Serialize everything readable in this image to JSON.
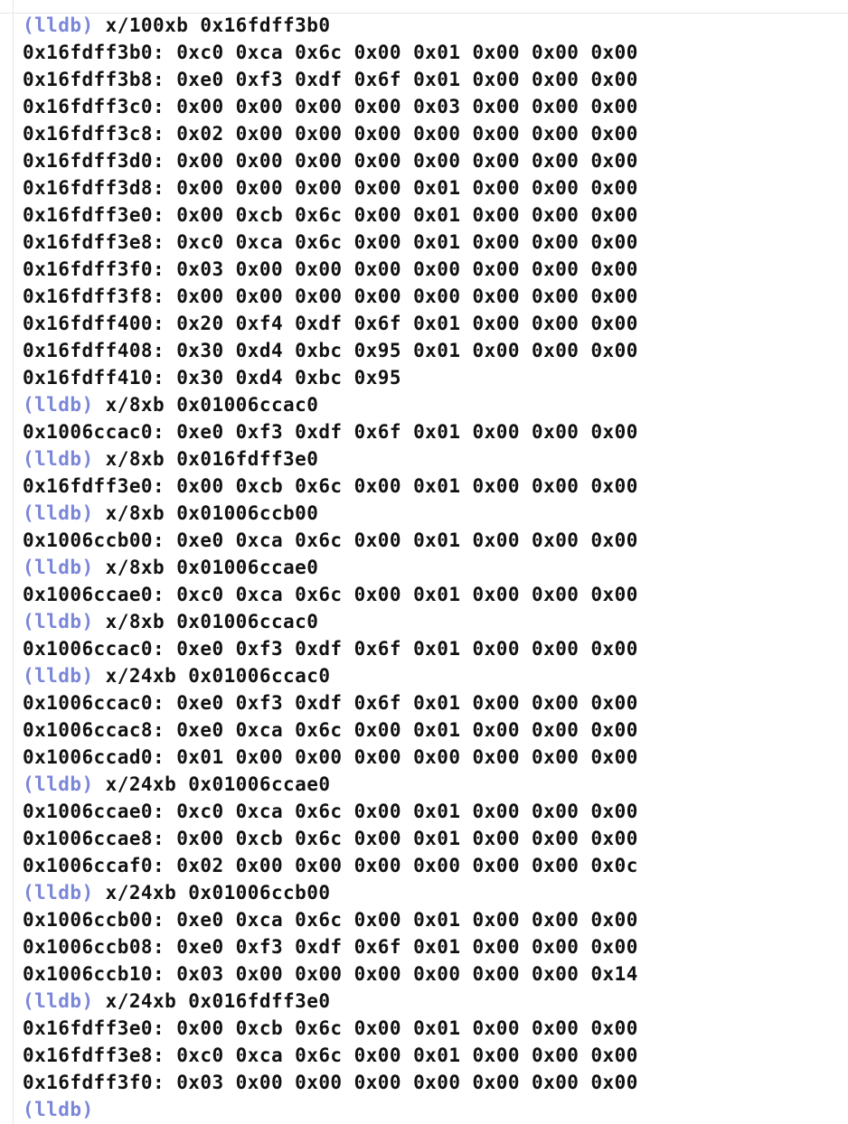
{
  "console": {
    "prompt": "(lldb)",
    "lines": [
      {
        "kind": "cmd",
        "text": "x/100xb 0x16fdff3b0"
      },
      {
        "kind": "out",
        "text": "0x16fdff3b0: 0xc0 0xca 0x6c 0x00 0x01 0x00 0x00 0x00"
      },
      {
        "kind": "out",
        "text": "0x16fdff3b8: 0xe0 0xf3 0xdf 0x6f 0x01 0x00 0x00 0x00"
      },
      {
        "kind": "out",
        "text": "0x16fdff3c0: 0x00 0x00 0x00 0x00 0x03 0x00 0x00 0x00"
      },
      {
        "kind": "out",
        "text": "0x16fdff3c8: 0x02 0x00 0x00 0x00 0x00 0x00 0x00 0x00"
      },
      {
        "kind": "out",
        "text": "0x16fdff3d0: 0x00 0x00 0x00 0x00 0x00 0x00 0x00 0x00"
      },
      {
        "kind": "out",
        "text": "0x16fdff3d8: 0x00 0x00 0x00 0x00 0x01 0x00 0x00 0x00"
      },
      {
        "kind": "out",
        "text": "0x16fdff3e0: 0x00 0xcb 0x6c 0x00 0x01 0x00 0x00 0x00"
      },
      {
        "kind": "out",
        "text": "0x16fdff3e8: 0xc0 0xca 0x6c 0x00 0x01 0x00 0x00 0x00"
      },
      {
        "kind": "out",
        "text": "0x16fdff3f0: 0x03 0x00 0x00 0x00 0x00 0x00 0x00 0x00"
      },
      {
        "kind": "out",
        "text": "0x16fdff3f8: 0x00 0x00 0x00 0x00 0x00 0x00 0x00 0x00"
      },
      {
        "kind": "out",
        "text": "0x16fdff400: 0x20 0xf4 0xdf 0x6f 0x01 0x00 0x00 0x00"
      },
      {
        "kind": "out",
        "text": "0x16fdff408: 0x30 0xd4 0xbc 0x95 0x01 0x00 0x00 0x00"
      },
      {
        "kind": "out",
        "text": "0x16fdff410: 0x30 0xd4 0xbc 0x95"
      },
      {
        "kind": "cmd",
        "text": "x/8xb 0x01006ccac0"
      },
      {
        "kind": "out",
        "text": "0x1006ccac0: 0xe0 0xf3 0xdf 0x6f 0x01 0x00 0x00 0x00"
      },
      {
        "kind": "cmd",
        "text": "x/8xb 0x016fdff3e0"
      },
      {
        "kind": "out",
        "text": "0x16fdff3e0: 0x00 0xcb 0x6c 0x00 0x01 0x00 0x00 0x00"
      },
      {
        "kind": "cmd",
        "text": "x/8xb 0x01006ccb00"
      },
      {
        "kind": "out",
        "text": "0x1006ccb00: 0xe0 0xca 0x6c 0x00 0x01 0x00 0x00 0x00"
      },
      {
        "kind": "cmd",
        "text": "x/8xb 0x01006ccae0"
      },
      {
        "kind": "out",
        "text": "0x1006ccae0: 0xc0 0xca 0x6c 0x00 0x01 0x00 0x00 0x00"
      },
      {
        "kind": "cmd",
        "text": "x/8xb 0x01006ccac0"
      },
      {
        "kind": "out",
        "text": "0x1006ccac0: 0xe0 0xf3 0xdf 0x6f 0x01 0x00 0x00 0x00"
      },
      {
        "kind": "cmd",
        "text": "x/24xb 0x01006ccac0"
      },
      {
        "kind": "out",
        "text": "0x1006ccac0: 0xe0 0xf3 0xdf 0x6f 0x01 0x00 0x00 0x00"
      },
      {
        "kind": "out",
        "text": "0x1006ccac8: 0xe0 0xca 0x6c 0x00 0x01 0x00 0x00 0x00"
      },
      {
        "kind": "out",
        "text": "0x1006ccad0: 0x01 0x00 0x00 0x00 0x00 0x00 0x00 0x00"
      },
      {
        "kind": "cmd",
        "text": "x/24xb 0x01006ccae0"
      },
      {
        "kind": "out",
        "text": "0x1006ccae0: 0xc0 0xca 0x6c 0x00 0x01 0x00 0x00 0x00"
      },
      {
        "kind": "out",
        "text": "0x1006ccae8: 0x00 0xcb 0x6c 0x00 0x01 0x00 0x00 0x00"
      },
      {
        "kind": "out",
        "text": "0x1006ccaf0: 0x02 0x00 0x00 0x00 0x00 0x00 0x00 0x0c"
      },
      {
        "kind": "cmd",
        "text": "x/24xb 0x01006ccb00"
      },
      {
        "kind": "out",
        "text": "0x1006ccb00: 0xe0 0xca 0x6c 0x00 0x01 0x00 0x00 0x00"
      },
      {
        "kind": "out",
        "text": "0x1006ccb08: 0xe0 0xf3 0xdf 0x6f 0x01 0x00 0x00 0x00"
      },
      {
        "kind": "out",
        "text": "0x1006ccb10: 0x03 0x00 0x00 0x00 0x00 0x00 0x00 0x14"
      },
      {
        "kind": "cmd",
        "text": "x/24xb 0x016fdff3e0"
      },
      {
        "kind": "out",
        "text": "0x16fdff3e0: 0x00 0xcb 0x6c 0x00 0x01 0x00 0x00 0x00"
      },
      {
        "kind": "out",
        "text": "0x16fdff3e8: 0xc0 0xca 0x6c 0x00 0x01 0x00 0x00 0x00"
      },
      {
        "kind": "out",
        "text": "0x16fdff3f0: 0x03 0x00 0x00 0x00 0x00 0x00 0x00 0x00"
      },
      {
        "kind": "prompt-only",
        "text": ""
      }
    ]
  },
  "colors": {
    "prompt": "#7a86d9",
    "text": "#111111",
    "background": "#ffffff"
  }
}
